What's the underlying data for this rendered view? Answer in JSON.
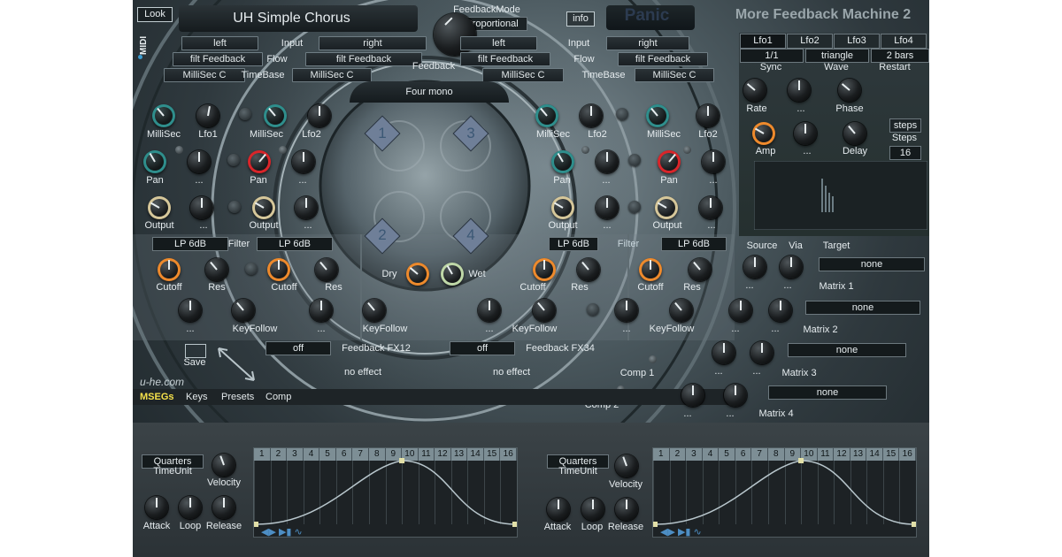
{
  "header": {
    "look": "Look",
    "preset_name": "UH Simple Chorus",
    "feedback_mode_label": "FeedbackMode",
    "feedback_mode_value": "Proportional",
    "info": "info",
    "panic": "Panic",
    "title": "More Feedback Machine 2",
    "midi": "MIDI"
  },
  "routing": {
    "left_input": "left",
    "right_input": "right",
    "left_input2": "left",
    "right_input2": "right",
    "input": "Input",
    "input2": "Input",
    "flow": "Flow",
    "flow2": "Flow",
    "timebase": "TimeBase",
    "timebase2": "TimeBase",
    "flow_l": "filt Feedback",
    "flow_r": "filt Feedback",
    "flow_l2": "filt Feedback",
    "flow_r2": "filt Feedback",
    "tb_l": "MilliSec C",
    "tb_r": "MilliSec C",
    "tb_l2": "MilliSec C",
    "tb_r2": "MilliSec C",
    "feedback": "Feedback",
    "four_mono": "Four mono"
  },
  "delay_ch": {
    "millisec": "MilliSec",
    "lfo1": "Lfo1",
    "lfo2": "Lfo2",
    "pan": "Pan",
    "output": "Output",
    "ellipsis": "...",
    "filter": "Filter",
    "lp": "LP 6dB",
    "cutoff": "Cutoff",
    "res": "Res",
    "keyfollow": "KeyFollow"
  },
  "center": {
    "n1": "1",
    "n2": "2",
    "n3": "3",
    "n4": "4",
    "dry": "Dry",
    "wet": "Wet"
  },
  "fx": {
    "off1": "off",
    "fx12": "Feedback FX12",
    "off2": "off",
    "fx34": "Feedback FX34",
    "noeffect1": "no effect",
    "noeffect2": "no effect",
    "comp1": "Comp 1",
    "comp2": "Comp 2"
  },
  "bottom_left": {
    "save": "Save",
    "brand": "u-he.com"
  },
  "tabs": [
    "MSEGs",
    "Keys",
    "Presets",
    "Comp"
  ],
  "lfo": {
    "tabs": [
      "Lfo1",
      "Lfo2",
      "Lfo3",
      "Lfo4"
    ],
    "sync_val": "1/1",
    "wave_val": "triangle",
    "restart_val": "2 bars",
    "sync": "Sync",
    "wave": "Wave",
    "restart": "Restart",
    "rate": "Rate",
    "ellipsis": "...",
    "phase": "Phase",
    "amp": "Amp",
    "delay": "Delay",
    "steps_btn": "steps",
    "steps": "Steps",
    "steps_val": "16"
  },
  "matrix": {
    "source": "Source",
    "via": "Via",
    "target": "Target",
    "none": "none",
    "m1": "Matrix 1",
    "m2": "Matrix 2",
    "m3": "Matrix 3",
    "m4": "Matrix 4",
    "ellipsis": "..."
  },
  "mseg": {
    "timeunit_val": "Quarters",
    "timeunit": "TimeUnit",
    "velocity": "Velocity",
    "attack": "Attack",
    "loop": "Loop",
    "release": "Release",
    "steps": [
      "1",
      "2",
      "3",
      "4",
      "5",
      "6",
      "7",
      "8",
      "9",
      "10",
      "11",
      "12",
      "13",
      "14",
      "15",
      "16"
    ]
  },
  "colors": {
    "accent_teal": "#2f8e8c",
    "accent_red": "#d9252a",
    "accent_orange": "#ee8a2c",
    "accent_tan": "#d6c79a",
    "active_tab": "#f4e04a"
  }
}
